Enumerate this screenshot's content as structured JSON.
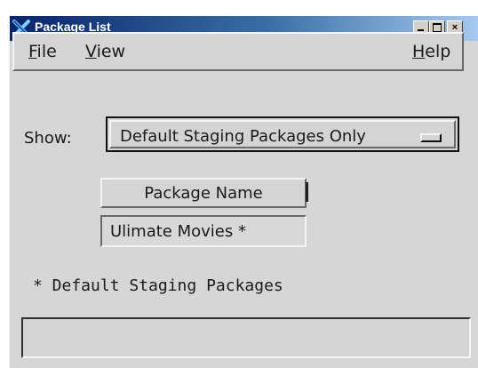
{
  "window": {
    "title": "Package List",
    "icon": "x-window-icon",
    "controls": {
      "minimize": "_",
      "maximize": "□",
      "close": "×"
    }
  },
  "menubar": {
    "file": {
      "mnemonic": "F",
      "rest": "ile"
    },
    "view": {
      "mnemonic": "V",
      "rest": "iew"
    },
    "help": {
      "mnemonic": "H",
      "rest": "elp"
    }
  },
  "filter": {
    "label": "Show:",
    "selected": "Default Staging Packages Only"
  },
  "table": {
    "header": "Package Name",
    "rows": [
      "Ulimate Movies *"
    ]
  },
  "footnote": "* Default Staging Packages",
  "status": "",
  "colors": {
    "titlebar_start": "#0a246a",
    "titlebar_end": "#a6caf0",
    "background": "#d6d6d6"
  }
}
